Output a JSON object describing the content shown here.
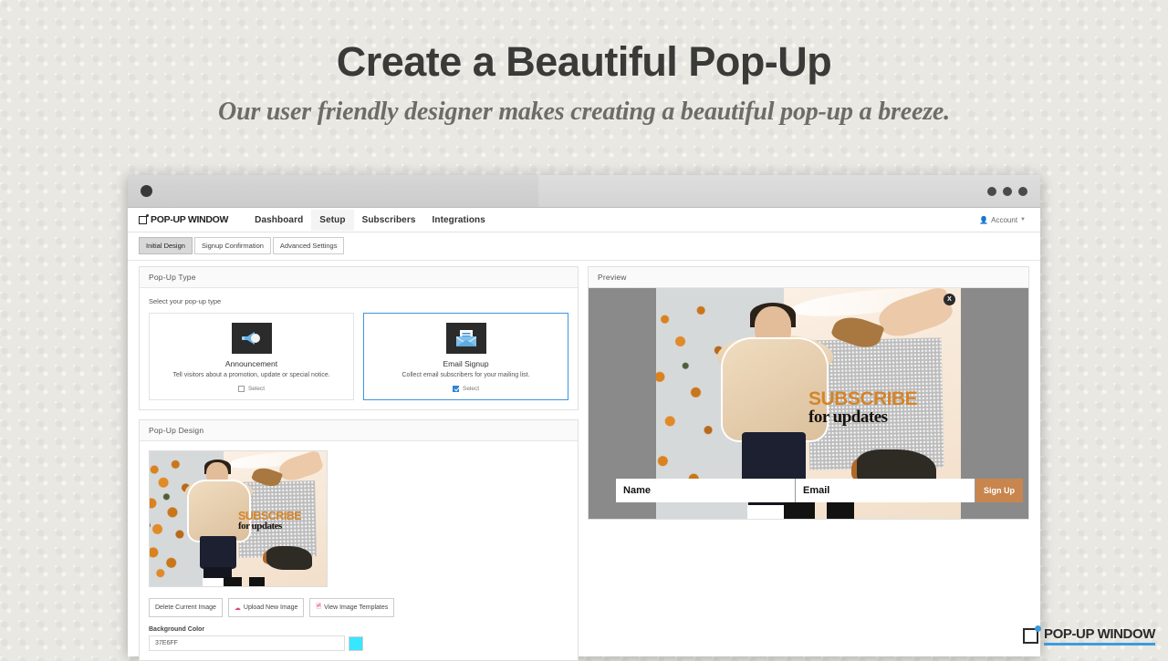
{
  "hero": {
    "title": "Create a Beautiful Pop-Up",
    "subtitle": "Our user friendly designer makes creating a beautiful pop-up a breeze."
  },
  "app": {
    "brand": "POP-UP WINDOW",
    "nav": [
      {
        "label": "Dashboard",
        "active": false
      },
      {
        "label": "Setup",
        "active": true
      },
      {
        "label": "Subscribers",
        "active": false
      },
      {
        "label": "Integrations",
        "active": false
      }
    ],
    "account": {
      "label": "Account",
      "icon": "user-icon",
      "caret": "▼"
    },
    "subtabs": [
      {
        "label": "Initial Design",
        "active": true
      },
      {
        "label": "Signup Confirmation",
        "active": false
      },
      {
        "label": "Advanced Settings",
        "active": false
      }
    ]
  },
  "popup_type": {
    "panel_title": "Pop-Up Type",
    "hint": "Select your pop-up type",
    "cards": [
      {
        "name": "Announcement",
        "desc": "Tell visitors about a promotion, update or special notice.",
        "icon": "megaphone-icon",
        "select_label": "Select",
        "selected": false
      },
      {
        "name": "Email Signup",
        "desc": "Collect email subscribers for your mailing list.",
        "icon": "envelope-icon",
        "select_label": "Select",
        "selected": true
      }
    ]
  },
  "popup_design": {
    "panel_title": "Pop-Up Design",
    "buttons": [
      {
        "label": "Delete Current Image",
        "icon": null
      },
      {
        "label": "Upload New Image",
        "icon": "cloud-upload-icon"
      },
      {
        "label": "View Image Templates",
        "icon": "image-templates-icon"
      }
    ],
    "background_color_label": "Background Color",
    "background_color_value": "37E6FF",
    "background_color_hex": "#37E6FF"
  },
  "preview": {
    "panel_title": "Preview",
    "backdrop_color": "#8a8a8a",
    "close_label": "X",
    "fields": [
      {
        "label": "Name"
      },
      {
        "label": "Email"
      }
    ],
    "submit_label": "Sign Up",
    "submit_color": "#c8854e"
  },
  "artwork": {
    "headline": "SUBSCRIBE",
    "subline": "for updates",
    "headline_color": "#d4842a"
  },
  "footer": {
    "logo_text": "POP-UP WINDOW",
    "accent_color": "#3e9bdb"
  }
}
